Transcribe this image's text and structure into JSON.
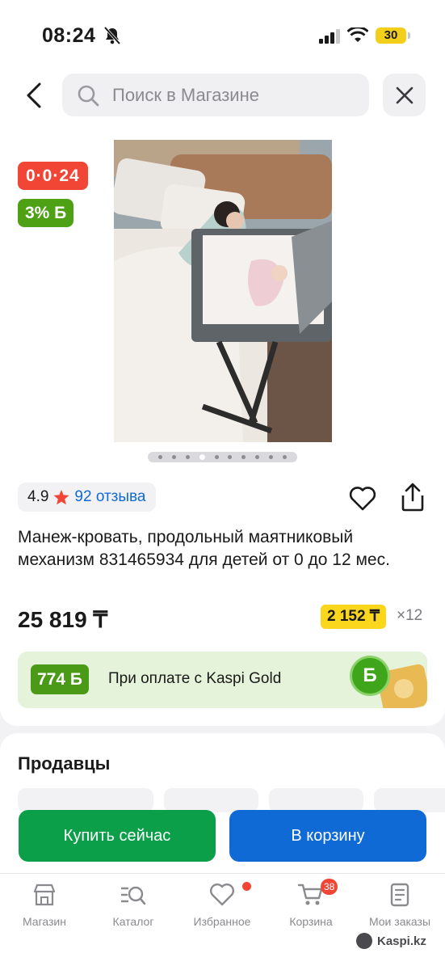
{
  "status_bar": {
    "time": "08:24",
    "battery": "30"
  },
  "header": {
    "search_placeholder": "Поиск в Магазине"
  },
  "product": {
    "badges": {
      "timer": "0·0·24",
      "bonus": "3% Б"
    },
    "rating": "4.9",
    "reviews": "92 отзыва",
    "title": "Манеж-кровать, продольный маятниковый механизм 831465934 для детей от 0 до 12 мес.",
    "price": "25 819 ₸",
    "installment": {
      "amount": "2 152 ₸",
      "term": "×12"
    },
    "photo_count": 10,
    "photo_active": 4
  },
  "kaspi_gold": {
    "amount": "774 Б",
    "text": "При оплате с Kaspi Gold",
    "coin": "Б"
  },
  "sellers": {
    "title": "Продавцы"
  },
  "actions": {
    "buy_now": "Купить сейчас",
    "to_cart": "В корзину"
  },
  "tabbar": {
    "shop": "Магазин",
    "catalog": "Каталог",
    "favorites": "Избранное",
    "cart": "Корзина",
    "cart_count": "38",
    "orders": "Мои заказы"
  },
  "watermark": "Kaspi.kz",
  "colors": {
    "kaspi_red": "#f14635",
    "bonus_green": "#4ea015",
    "buy_green": "#0c9f4a",
    "cart_blue": "#0f6ad6",
    "installment_yellow": "#fad61d"
  }
}
